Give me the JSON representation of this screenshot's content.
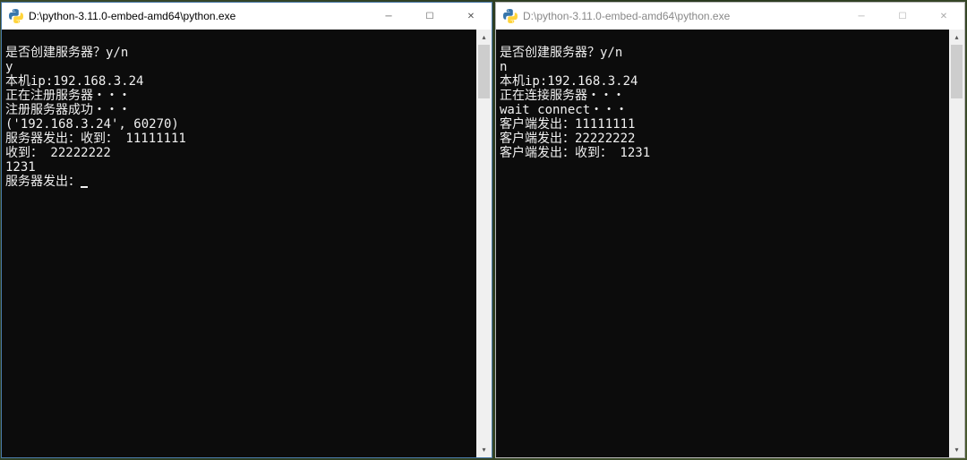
{
  "windows": {
    "left": {
      "title": "D:\\python-3.11.0-embed-amd64\\python.exe",
      "active": true,
      "lines": [
        "是否创建服务器？y/n",
        "y",
        "本机ip:192.168.3.24",
        "正在注册服务器・・・",
        "注册服务器成功・・・",
        "('192.168.3.24', 60270)",
        "服务器发出：收到： 11111111",
        "收到： 22222222",
        "1231",
        "服务器发出："
      ]
    },
    "right": {
      "title": "D:\\python-3.11.0-embed-amd64\\python.exe",
      "active": false,
      "lines": [
        "是否创建服务器？y/n",
        "n",
        "本机ip:192.168.3.24",
        "正在连接服务器・・・",
        "wait connect・・・",
        "客户端发出：11111111",
        "客户端发出：22222222",
        "客户端发出：收到： 1231"
      ]
    }
  },
  "controls": {
    "minimize": "─",
    "maximize": "☐",
    "close": "✕"
  }
}
